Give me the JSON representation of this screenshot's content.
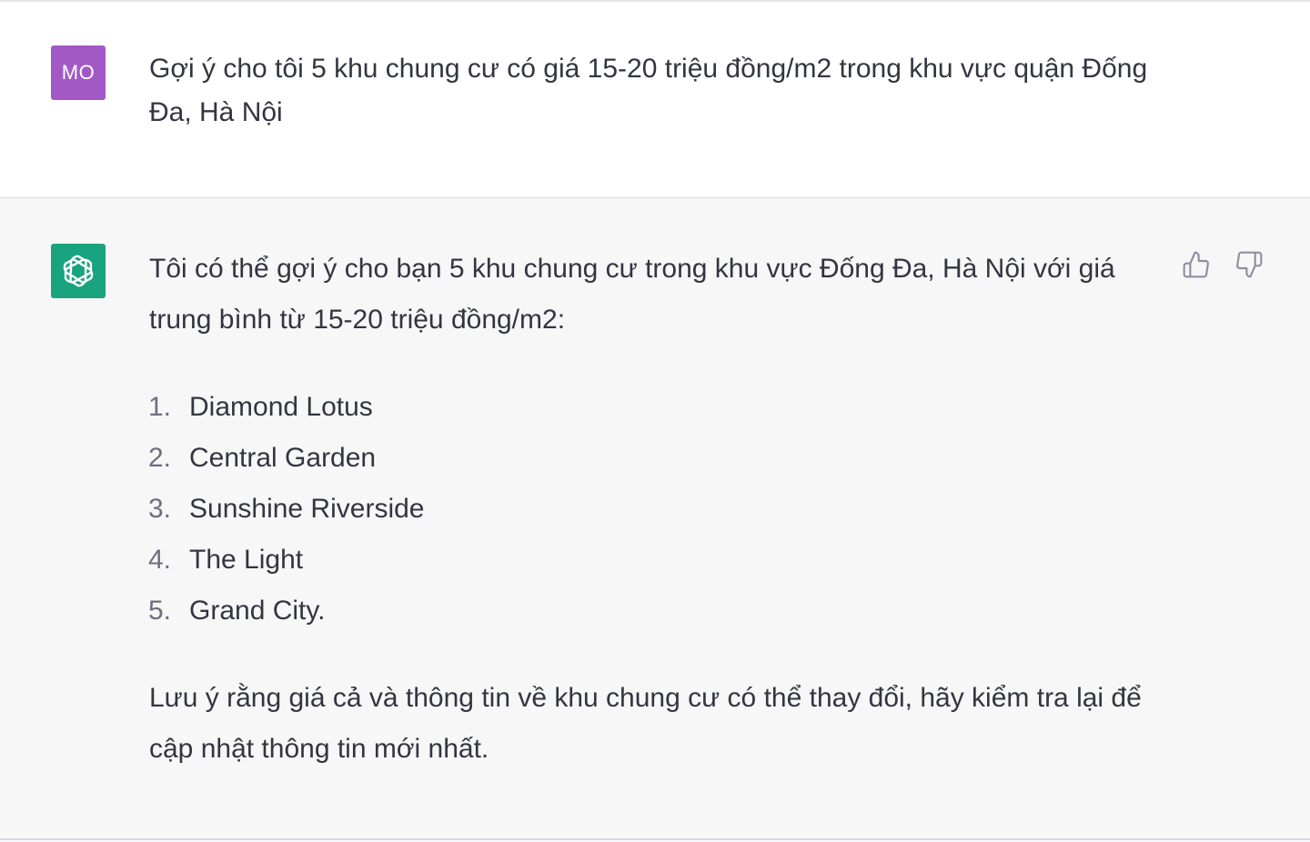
{
  "colors": {
    "user_avatar_bg": "#9b59c6",
    "bot_avatar_bg": "#10a37f",
    "text": "#343541",
    "icon": "#8e8ea0"
  },
  "user_message": {
    "avatar_initials": "MO",
    "text": "Gợi ý cho tôi 5 khu chung cư có giá 15-20 triệu đồng/m2 trong khu vực quận Đống Đa, Hà Nội"
  },
  "assistant_message": {
    "avatar_icon": "openai-logo-icon",
    "intro": "Tôi có thể gợi ý cho bạn 5 khu chung cư trong khu vực Đống Đa, Hà Nội với giá trung bình từ 15-20 triệu đồng/m2:",
    "items": [
      {
        "num": "1.",
        "label": "Diamond Lotus"
      },
      {
        "num": "2.",
        "label": "Central Garden"
      },
      {
        "num": "3.",
        "label": "Sunshine Riverside"
      },
      {
        "num": "4.",
        "label": "The Light"
      },
      {
        "num": "5.",
        "label": "Grand City."
      }
    ],
    "outro": "Lưu ý rằng giá cả và thông tin về khu chung cư có thể thay đổi, hãy kiểm tra lại để cập nhật thông tin mới nhất.",
    "actions": {
      "thumbs_up_icon": "thumbs-up-icon",
      "thumbs_down_icon": "thumbs-down-icon"
    }
  }
}
